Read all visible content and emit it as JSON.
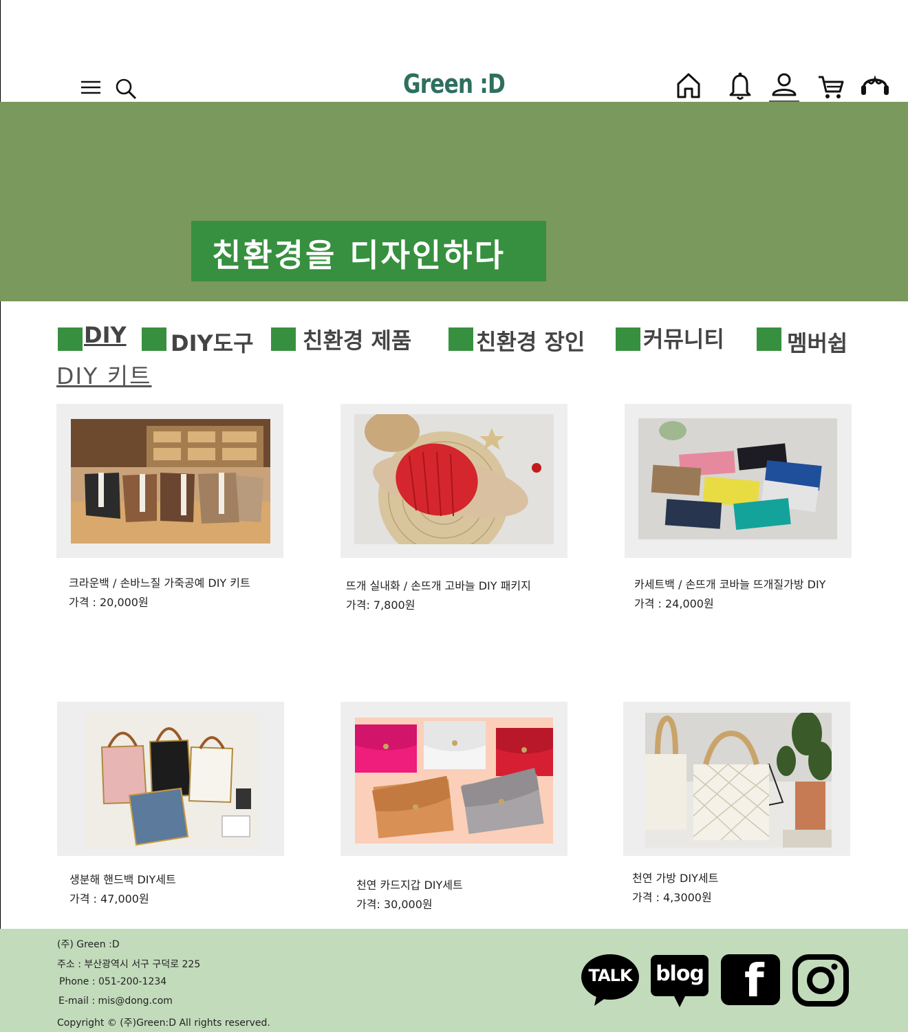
{
  "header": {
    "logo": "Green :D",
    "icons": [
      "menu-icon",
      "search-icon",
      "home-icon",
      "bell-icon",
      "user-icon",
      "cart-icon",
      "customer-service-icon"
    ]
  },
  "hero": {
    "slogan": "친환경을 디자인하다"
  },
  "nav": {
    "items": [
      {
        "label": "DIY"
      },
      {
        "label": "DIY도구"
      },
      {
        "label": "친환경 제품"
      },
      {
        "label": "친환경 장인"
      },
      {
        "label": "커뮤니티"
      },
      {
        "label": "멤버쉽"
      }
    ],
    "sub_heading": "DIY 키트"
  },
  "products": [
    {
      "name": "크라운백 /  손바느질 가죽공예 DIY 키트",
      "price": "가격 : 20,000원",
      "image": "leather-bags-photo"
    },
    {
      "name": "뜨개 실내화 / 손뜨개 고바늘 DIY 패키지",
      "price": "가격: 7,800원",
      "image": "knit-slipper-photo"
    },
    {
      "name": "카세트백 / 손뜨개 코바늘 뜨개질가방 DIY",
      "price": "가격 :  24,000원",
      "image": "cassette-bags-photo"
    },
    {
      "name": "생분해 핸드백  DIY세트",
      "price": "가격 : 47,000원",
      "image": "handbags-photo"
    },
    {
      "name": "천연 카드지갑 DIY세트",
      "price": "가격: 30,000원",
      "image": "card-wallets-photo"
    },
    {
      "name": "천연 가방 DIY세트",
      "price": "가격 : 4,3000원",
      "image": "macrame-bag-photo"
    }
  ],
  "footer": {
    "company": "(주) Green :D",
    "address": "주소 : 부산광역시 서구 구덕로 225",
    "phone": "Phone : 051-200-1234",
    "email": "E-mail : mis@dong.com",
    "copyright": "Copyright © (주)Green:D All rights reserved.",
    "social": {
      "talk": "TALK",
      "blog": "blog",
      "facebook": "f"
    }
  },
  "colors": {
    "hero_bg": "#7a995c",
    "accent_green": "#37903f",
    "footer_bg": "#c2dbbb",
    "logo_color": "#2e6f5e"
  }
}
